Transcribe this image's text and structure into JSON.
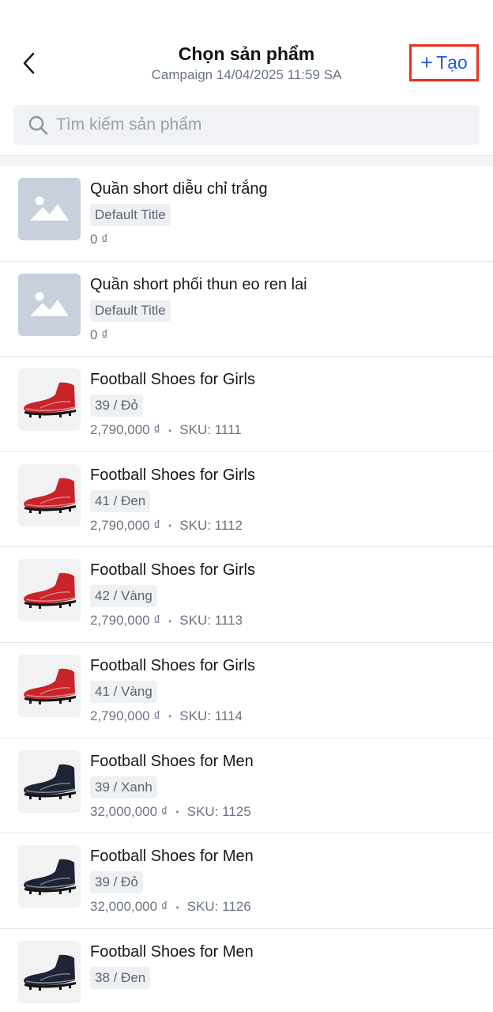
{
  "header": {
    "title": "Chọn sản phẩm",
    "subtitle": "Campaign 14/04/2025 11:59 SA",
    "create_label": "Tạo",
    "create_plus": "+"
  },
  "search": {
    "placeholder": "Tìm kiếm sản phẩm",
    "value": ""
  },
  "colors": {
    "accent": "#1f5fd6",
    "highlight_border": "#e8311d",
    "shoe_red": "#c8242a",
    "shoe_navy": "#1e2436"
  },
  "products": [
    {
      "name": "Quần short diễu chỉ trắng",
      "variant": "Default Title",
      "price": "0 ₫",
      "sku": "",
      "image": "placeholder-image-icon"
    },
    {
      "name": "Quần short phối thun eo ren lai",
      "variant": "Default Title",
      "price": "0 ₫",
      "sku": "",
      "image": "placeholder-image-icon"
    },
    {
      "name": "Football Shoes for Girls",
      "variant": "39 / Đỏ",
      "price": "2,790,000 ₫",
      "sku": "SKU: 1111",
      "image": "red-football-shoe"
    },
    {
      "name": "Football Shoes for Girls",
      "variant": "41 / Đen",
      "price": "2,790,000 ₫",
      "sku": "SKU: 1112",
      "image": "red-football-shoe"
    },
    {
      "name": "Football Shoes for Girls",
      "variant": "42 / Vàng",
      "price": "2,790,000 ₫",
      "sku": "SKU: 1113",
      "image": "red-football-shoe"
    },
    {
      "name": "Football Shoes for Girls",
      "variant": "41 / Vàng",
      "price": "2,790,000 ₫",
      "sku": "SKU: 1114",
      "image": "red-football-shoe"
    },
    {
      "name": "Football Shoes for Men",
      "variant": "39 / Xanh",
      "price": "32,000,000 ₫",
      "sku": "SKU: 1125",
      "image": "navy-football-shoe"
    },
    {
      "name": "Football Shoes for Men",
      "variant": "39 / Đỏ",
      "price": "32,000,000 ₫",
      "sku": "SKU: 1126",
      "image": "navy-football-shoe"
    },
    {
      "name": "Football Shoes for Men",
      "variant": "38 / Đen",
      "price": "",
      "sku": "",
      "image": "navy-football-shoe"
    }
  ]
}
